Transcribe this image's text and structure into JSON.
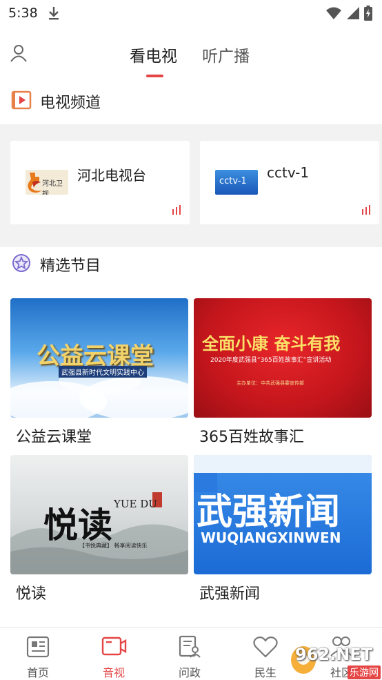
{
  "status_bar": {
    "time": "5:38"
  },
  "header": {
    "tabs": [
      {
        "label": "看电视",
        "active": true
      },
      {
        "label": "听广播",
        "active": false
      }
    ],
    "accent_color": "#e54545"
  },
  "tv_section": {
    "title": "电视频道",
    "channels": [
      {
        "name": "河北电视台",
        "logo_text": "河北卫视",
        "icon": "hebei-tv-logo"
      },
      {
        "name": "cctv-1",
        "logo_text": "cctv-1",
        "icon": "cctv1-logo"
      }
    ]
  },
  "featured_section": {
    "title": "精选节目",
    "programs": [
      {
        "title": "公益云课堂",
        "thumb_text": "公益云课堂",
        "thumb_sub": "武强县新时代文明实践中心"
      },
      {
        "title": "365百姓故事汇",
        "thumb_text": "全面小康 奋斗有我",
        "thumb_sub": "2020年度武强县“365百姓故事汇”宣讲活动",
        "thumb_sub2": "主办单位：中共武强县委宣传部"
      },
      {
        "title": "悦读",
        "thumb_text": "悦读",
        "thumb_sub": "YUE DU",
        "thumb_sub2": "【书悦典藏】 畅享阅读快乐"
      },
      {
        "title": "武强新闻",
        "thumb_text": "武强新闻",
        "thumb_sub": "WUQIANGXINWEN"
      }
    ]
  },
  "bottom_nav": {
    "items": [
      {
        "label": "首页",
        "icon": "news-icon",
        "active": false
      },
      {
        "label": "音视",
        "icon": "video-icon",
        "active": true
      },
      {
        "label": "问政",
        "icon": "document-user-icon",
        "active": false
      },
      {
        "label": "民生",
        "icon": "heart-icon",
        "active": false
      },
      {
        "label": "社区",
        "icon": "community-icon",
        "active": false
      }
    ]
  },
  "watermark": {
    "text": "962.NET",
    "sub": "乐游网"
  }
}
